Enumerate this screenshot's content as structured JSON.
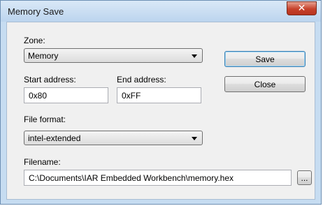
{
  "window": {
    "title": "Memory Save",
    "close_glyph": "✕"
  },
  "zone": {
    "label": "Zone:",
    "value": "Memory"
  },
  "start_address": {
    "label": "Start address:",
    "value": "0x80"
  },
  "end_address": {
    "label": "End address:",
    "value": "0xFF"
  },
  "file_format": {
    "label": "File format:",
    "value": "intel-extended"
  },
  "filename": {
    "label": "Filename:",
    "value": "C:\\Documents\\IAR Embedded Workbench\\memory.hex",
    "browse_label": "..."
  },
  "buttons": {
    "save": "Save",
    "close": "Close"
  }
}
